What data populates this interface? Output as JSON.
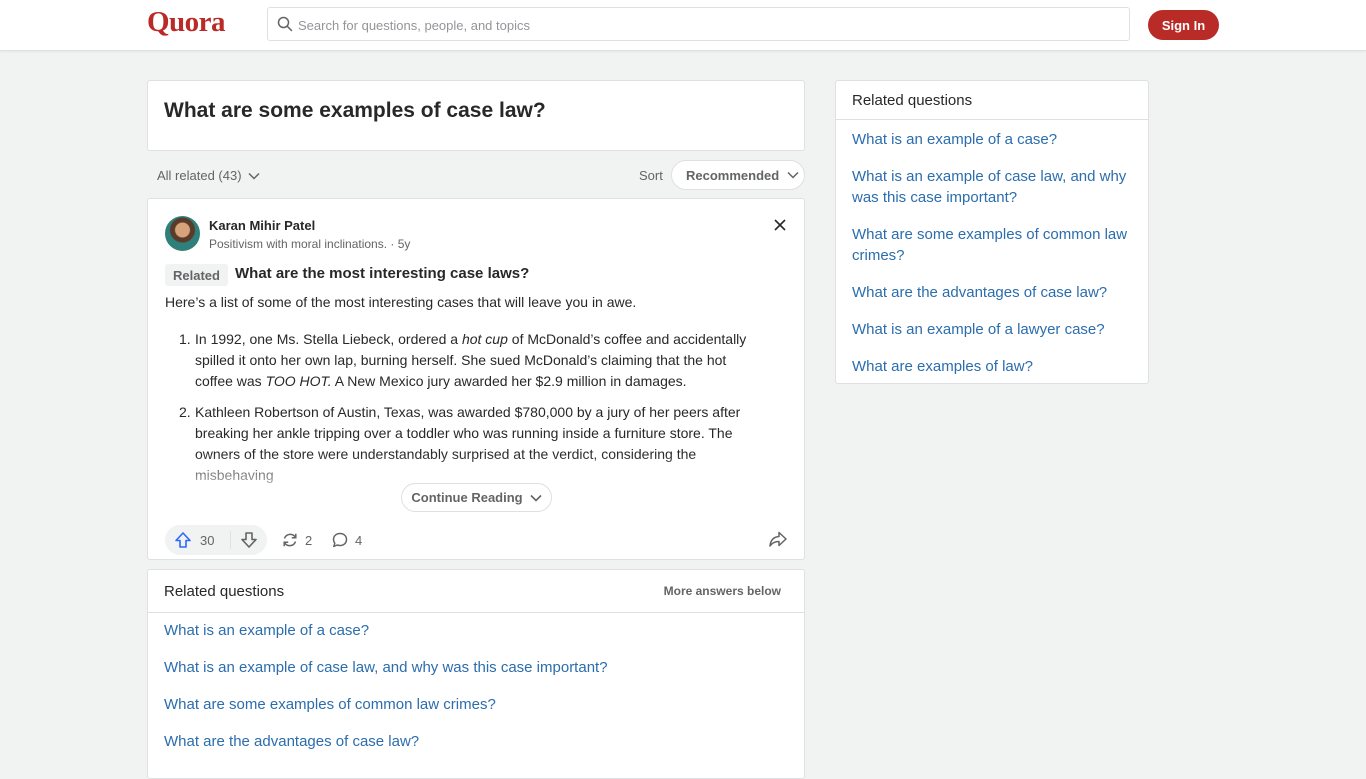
{
  "header": {
    "logo": "Quora",
    "search_placeholder": "Search for questions, people, and topics",
    "sign_in_label": "Sign In"
  },
  "question": {
    "title": "What are some examples of case law?"
  },
  "filters": {
    "all_related_label": "All related (43)",
    "sort_label": "Sort",
    "sort_value": "Recommended"
  },
  "answer": {
    "author_name": "Karan Mihir Patel",
    "author_credential": "Positivism with moral inclinations. · 5y",
    "related_tag": "Related",
    "related_question": "What are the most interesting case laws?",
    "intro": "Here’s a list of some of the most interesting cases that will leave you in awe.",
    "items": [
      {
        "num": "1.",
        "parts": {
          "a": "In 1992, one Ms. Stella Liebeck, ordered a ",
          "b": "hot cup",
          "c": " of McDonald’s coffee and accidentally spilled it onto her own lap, burning herself. She sued McDonald’s claiming that the hot coffee was ",
          "d": "TOO HOT.",
          "e": " A New Mexico jury awarded her $2.9 million in damages."
        }
      },
      {
        "num": "2.",
        "text": "Kathleen Robertson of Austin, Texas, was awarded $780,000 by a jury of her peers after breaking her ankle tripping over a toddler who was running inside a furniture store. The owners of the store were understandably surprised at the verdict, considering the misbehaving"
      }
    ],
    "continue_label": "Continue Reading",
    "upvotes": "30",
    "shares": "2",
    "comments": "4"
  },
  "related_main": {
    "heading": "Related questions",
    "more_label": "More answers below",
    "items": [
      "What is an example of a case?",
      "What is an example of case law, and why was this case important?",
      "What are some examples of common law crimes?",
      "What are the advantages of case law?"
    ]
  },
  "related_side": {
    "heading": "Related questions",
    "items": [
      "What is an example of a case?",
      "What is an example of case law, and why was this case important?",
      "What are some examples of common law crimes?",
      "What are the advantages of case law?",
      "What is an example of a lawyer case?",
      "What are examples of law?"
    ]
  },
  "colors": {
    "brand": "#b92b27",
    "link": "#2b6dad",
    "upvote": "#2e69ff"
  }
}
